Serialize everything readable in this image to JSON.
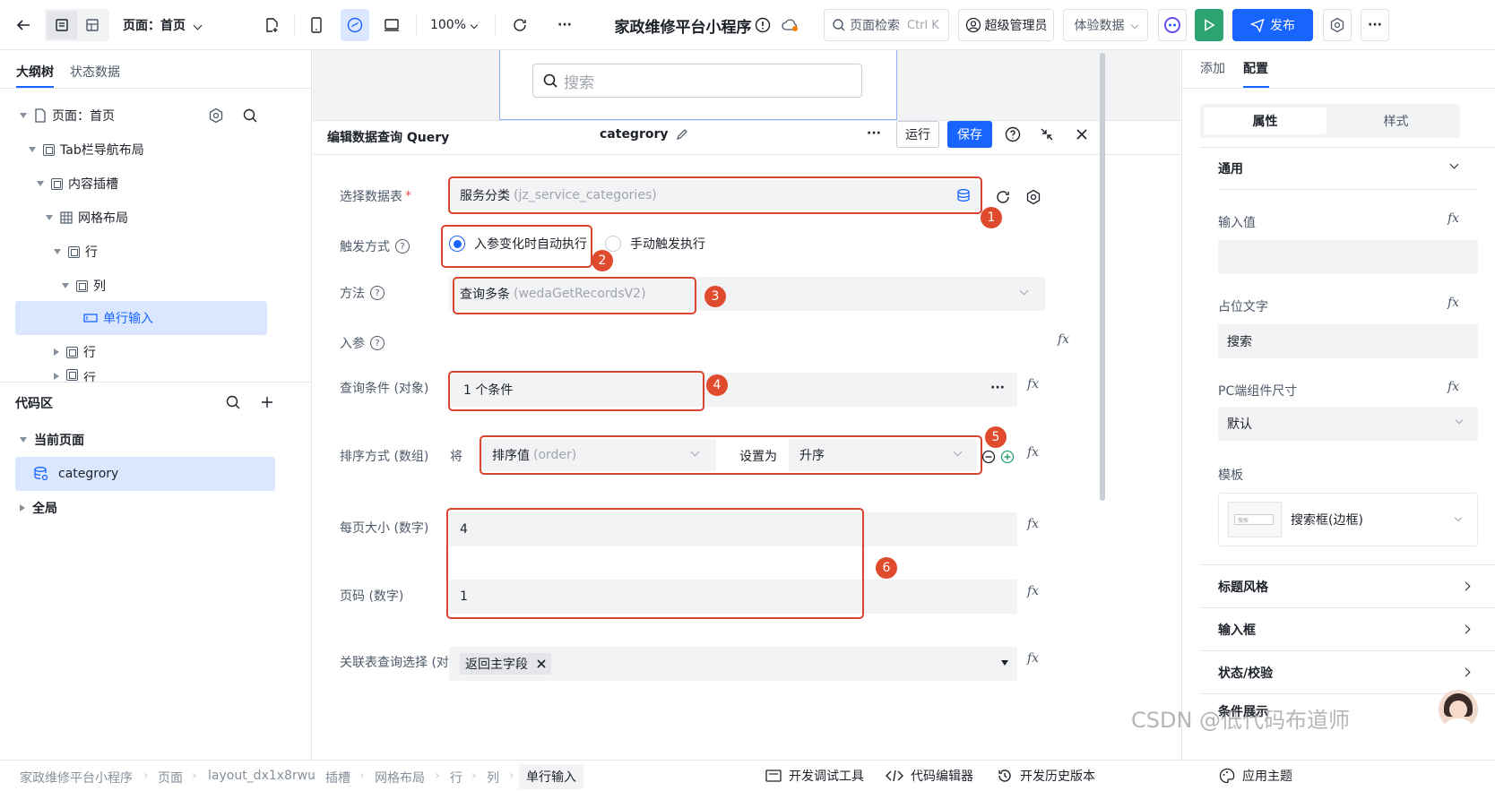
{
  "topbar": {
    "page_label": "页面：首页",
    "zoom": "100%",
    "more": "···",
    "app_title": "家政维修平台小程序",
    "search_placeholder": "页面检索",
    "search_shortcut": "Ctrl K",
    "admin": "超级管理员",
    "data_mode": "体验数据",
    "publish": "发布",
    "more_right": "···"
  },
  "left": {
    "tabs": [
      "大纲树",
      "状态数据"
    ],
    "tree": [
      {
        "label": "页面：首页"
      },
      {
        "label": "Tab栏导航布局"
      },
      {
        "label": "内容插槽"
      },
      {
        "label": "网格布局"
      },
      {
        "label": "行"
      },
      {
        "label": "列"
      },
      {
        "label": "单行输入"
      },
      {
        "label": "行"
      },
      {
        "label": "行"
      }
    ],
    "code_title": "代码区",
    "current_page": "当前页面",
    "query_item": "categrory",
    "global": "全局"
  },
  "canvas": {
    "search_placeholder": "搜索"
  },
  "dialog": {
    "title": "编辑数据查询 Query",
    "query_name": "categrory",
    "more": "···",
    "run": "运行",
    "save": "保存",
    "fields": {
      "table_label": "选择数据表",
      "table_value": "服务分类",
      "table_code": "(jz_service_categories)",
      "trigger_label": "触发方式",
      "trigger_auto": "入参变化时自动执行",
      "trigger_manual": "手动触发执行",
      "method_label": "方法",
      "method_value": "查询多条",
      "method_code": "(wedaGetRecordsV2)",
      "params_label": "入参",
      "cond_label": "查询条件 (对象)",
      "cond_value": "1 个条件",
      "cond_more": "···",
      "sort_label": "排序方式 (数组)",
      "sort_prefix": "将",
      "sort_field": "排序值",
      "sort_field_code": "(order)",
      "sort_setas": "设置为",
      "sort_dir": "升序",
      "pagesize_label": "每页大小 (数字)",
      "pagesize_value": "4",
      "page_label": "页码 (数字)",
      "page_value": "1",
      "join_label": "关联表查询选择 (对象)",
      "join_tag": "返回主字段"
    },
    "fx": "fx",
    "badges": [
      "1",
      "2",
      "3",
      "4",
      "5",
      "6"
    ]
  },
  "right": {
    "tabs": [
      "添加",
      "配置"
    ],
    "subtabs": [
      "属性",
      "样式"
    ],
    "general": "通用",
    "input_value_label": "输入值",
    "placeholder_label": "占位文字",
    "placeholder_value": "搜索",
    "pc_size_label": "PC端组件尺寸",
    "pc_size_value": "默认",
    "template_label": "模板",
    "template_thumb_text": "搜索",
    "template_value": "搜索框(边框)",
    "sections": [
      "标题风格",
      "输入框",
      "状态/校验",
      "条件展示"
    ]
  },
  "bottom": {
    "crumbs": [
      "家政维修平台小程序",
      "页面",
      "layout_dx1x8rwu",
      "插槽",
      "网格布局",
      "行",
      "列",
      "单行输入"
    ],
    "dev_tools": "开发调试工具",
    "code_editor": "代码编辑器",
    "history": "开发历史版本",
    "theme": "应用主题"
  },
  "watermark": "CSDN @低代码布道师",
  "colors": {
    "accent": "#1764ff",
    "annotation": "#d9442f",
    "run_green": "#2ba471"
  }
}
